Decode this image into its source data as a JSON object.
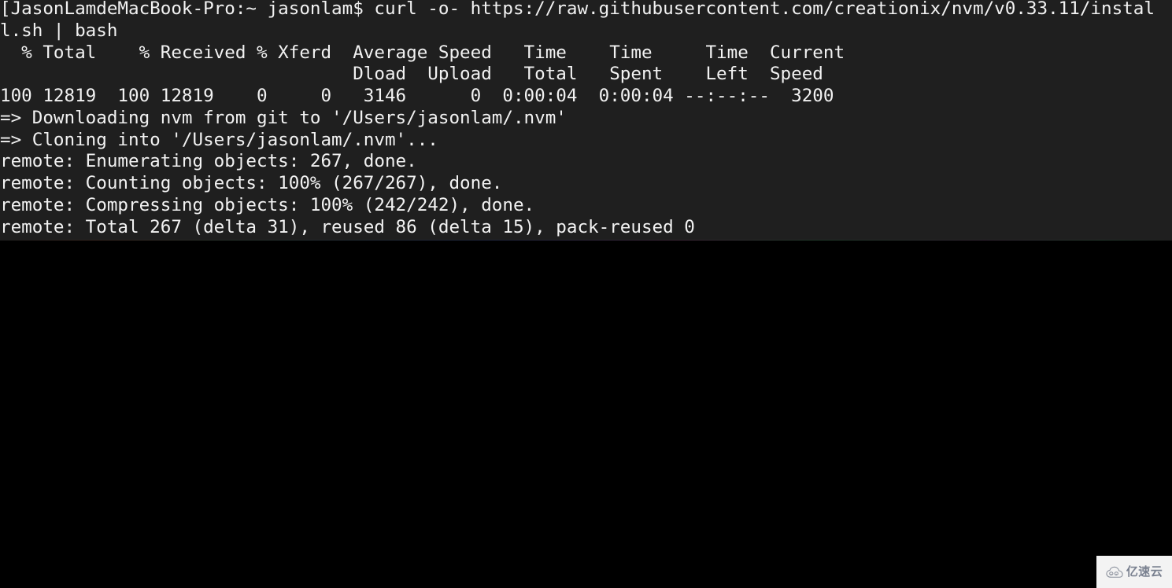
{
  "terminal": {
    "background_color": "#1f1f1f",
    "foreground_color": "#f2f2f2",
    "prompt_host": "JasonLamdeMacBook-Pro",
    "prompt_cwd": "~",
    "prompt_user": "jasonlam",
    "lines": [
      "[JasonLamdeMacBook-Pro:~ jasonlam$ curl -o- https://raw.githubusercontent.com/creationix/nvm/v0.33.11/instal",
      "l.sh | bash",
      "  % Total    % Received % Xferd  Average Speed   Time    Time     Time  Current",
      "                                 Dload  Upload   Total   Spent    Left  Speed",
      "100 12819  100 12819    0     0   3146      0  0:00:04  0:00:04 --:--:--  3200",
      "=> Downloading nvm from git to '/Users/jasonlam/.nvm'",
      "=> Cloning into '/Users/jasonlam/.nvm'...",
      "remote: Enumerating objects: 267, done.",
      "remote: Counting objects: 100% (267/267), done.",
      "remote: Compressing objects: 100% (242/242), done.",
      "remote: Total 267 (delta 31), reused 86 (delta 15), pack-reused 0"
    ],
    "command": "curl -o- https://raw.githubusercontent.com/creationix/nvm/v0.33.11/install.sh | bash",
    "curl_progress": {
      "headers_row1": [
        "% Total",
        "% Received",
        "% Xferd",
        "Average Speed",
        "Time",
        "Time",
        "Time",
        "Current"
      ],
      "headers_row2": [
        "Dload",
        "Upload",
        "Total",
        "Spent",
        "Left",
        "Speed"
      ],
      "values": {
        "percent_total": "100",
        "total": "12819",
        "percent_received": "100",
        "received": "12819",
        "percent_xferd": "0",
        "xferd": "0",
        "dload": "3146",
        "upload": "0",
        "time_total": "0:00:04",
        "time_spent": "0:00:04",
        "time_left": "--:--:--",
        "current_speed": "3200"
      }
    }
  },
  "watermark": {
    "text": "亿速云",
    "icon": "cloud-icon",
    "background_color": "#f3f3f3",
    "text_color": "#7a8190"
  }
}
